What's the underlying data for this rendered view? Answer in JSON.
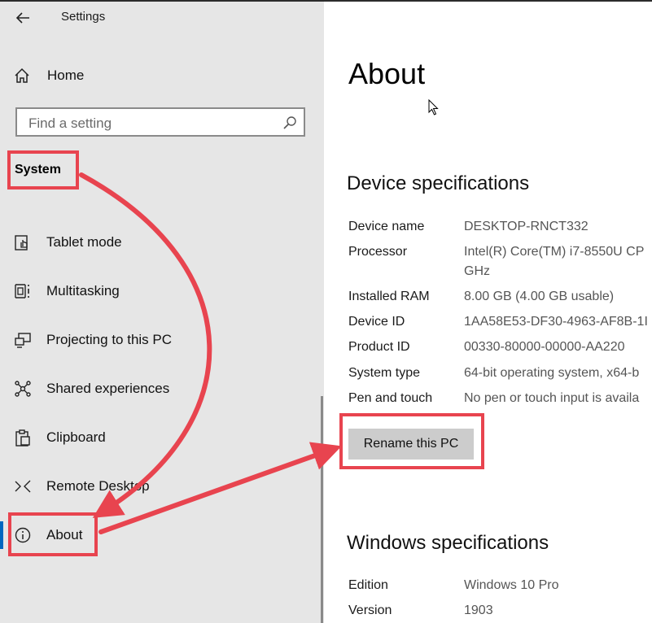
{
  "window": {
    "title": "Settings"
  },
  "sidebar": {
    "home_label": "Home",
    "search_placeholder": "Find a setting",
    "section_title": "System",
    "items": [
      {
        "label": "Tablet mode",
        "icon": "tablet-mode-icon"
      },
      {
        "label": "Multitasking",
        "icon": "multitasking-icon"
      },
      {
        "label": "Projecting to this PC",
        "icon": "projecting-icon"
      },
      {
        "label": "Shared experiences",
        "icon": "shared-experiences-icon"
      },
      {
        "label": "Clipboard",
        "icon": "clipboard-icon"
      },
      {
        "label": "Remote Desktop",
        "icon": "remote-desktop-icon"
      },
      {
        "label": "About",
        "icon": "info-icon",
        "selected": true
      }
    ]
  },
  "main": {
    "title": "About",
    "device_specs": {
      "heading": "Device specifications",
      "rows": [
        {
          "label": "Device name",
          "value": "DESKTOP-RNCT332"
        },
        {
          "label": "Processor",
          "value": "Intel(R) Core(TM) i7-8550U CP",
          "value2": "GHz"
        },
        {
          "label": "Installed RAM",
          "value": "8.00 GB (4.00 GB usable)"
        },
        {
          "label": "Device ID",
          "value": "1AA58E53-DF30-4963-AF8B-1I"
        },
        {
          "label": "Product ID",
          "value": "00330-80000-00000-AA220"
        },
        {
          "label": "System type",
          "value": "64-bit operating system, x64-b"
        },
        {
          "label": "Pen and touch",
          "value": "No pen or touch input is availa"
        }
      ],
      "rename_button": "Rename this PC"
    },
    "windows_specs": {
      "heading": "Windows specifications",
      "rows": [
        {
          "label": "Edition",
          "value": "Windows 10 Pro"
        },
        {
          "label": "Version",
          "value": "1903"
        }
      ]
    }
  },
  "annotation": {
    "color": "#e8444f",
    "accent": "#0067c0"
  }
}
